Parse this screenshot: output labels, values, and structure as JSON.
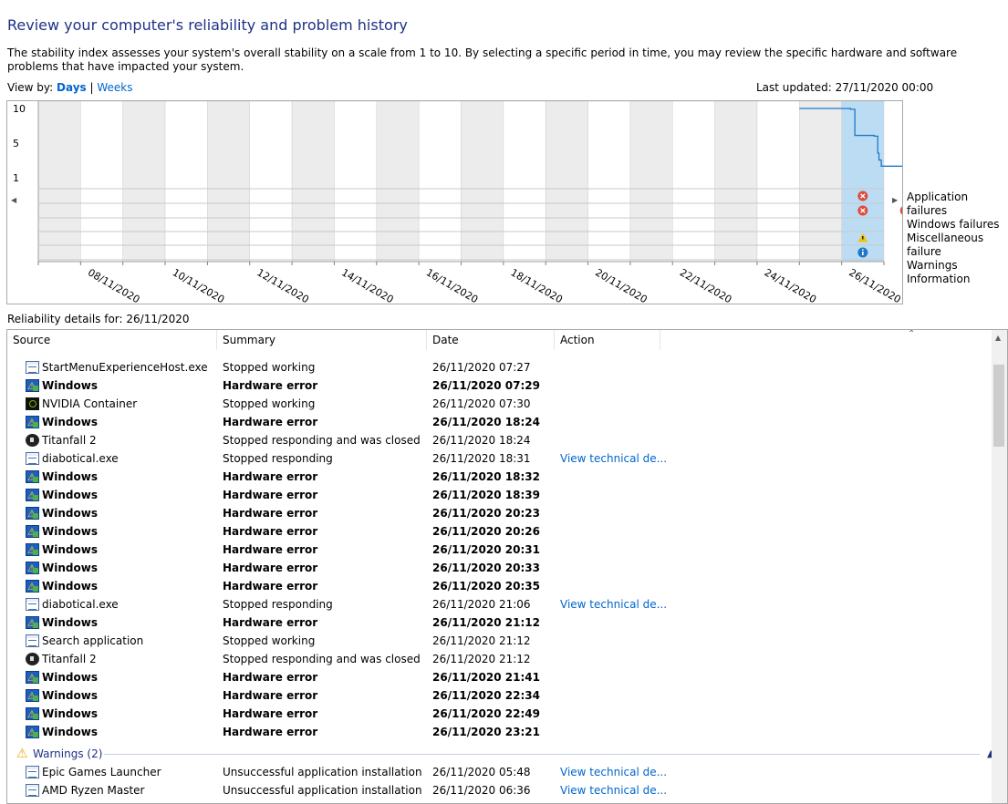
{
  "page": {
    "title": "Review your computer's reliability and problem history",
    "description": "The stability index assesses your system's overall stability on a scale from 1 to 10. By selecting a specific period in time, you may review the specific hardware and software problems that have impacted your system.",
    "view_by_label": "View by:",
    "view_days": "Days",
    "view_sep": "|",
    "view_weeks": "Weeks",
    "last_updated": "Last updated: 27/11/2020 00:00",
    "details_for": "Reliability details for: 26/11/2020"
  },
  "chart_data": {
    "type": "line",
    "y_ticks": [
      "10",
      "5",
      "1"
    ],
    "ylim": [
      1,
      10
    ],
    "x_labels": [
      "08/11/2020",
      "10/11/2020",
      "12/11/2020",
      "14/11/2020",
      "16/11/2020",
      "18/11/2020",
      "20/11/2020",
      "22/11/2020",
      "24/11/2020",
      "26/11/2020"
    ],
    "selected_day": "26/11/2020",
    "stability_index": [
      {
        "x": "25/11/2020 00:00",
        "y": 10.0
      },
      {
        "x": "26/11/2020 00:00",
        "y": 10.0
      },
      {
        "x": "26/11/2020 05:00",
        "y": 9.9
      },
      {
        "x": "26/11/2020 07:30",
        "y": 6.5
      },
      {
        "x": "26/11/2020 18:30",
        "y": 6.4
      },
      {
        "x": "26/11/2020 20:30",
        "y": 4.2
      },
      {
        "x": "26/11/2020 21:10",
        "y": 3.3
      },
      {
        "x": "26/11/2020 22:30",
        "y": 2.5
      },
      {
        "x": "27/11/2020 00:00",
        "y": 2.5
      },
      {
        "x": "28/11/2020 00:00",
        "y": 2.5
      }
    ],
    "event_rows": [
      "Application failures",
      "Windows failures",
      "Miscellaneous failure",
      "Warnings",
      "Information"
    ],
    "events": [
      {
        "row": "Application failures",
        "day": "26/11/2020",
        "icon": "error-icon"
      },
      {
        "row": "Windows failures",
        "day": "26/11/2020",
        "icon": "error-icon"
      },
      {
        "row": "Windows failures",
        "day": "27/11/2020",
        "icon": "error-icon"
      },
      {
        "row": "Warnings",
        "day": "26/11/2020",
        "icon": "warning-icon"
      },
      {
        "row": "Information",
        "day": "26/11/2020",
        "icon": "info-icon"
      }
    ],
    "colors": {
      "line": "#1e78c8",
      "selected": "#bcdcf4",
      "shade": "#ececec",
      "error": "#e04a3c",
      "warning": "#f5c400",
      "info": "#1e78c8"
    }
  },
  "table": {
    "headers": [
      "Source",
      "Summary",
      "Date",
      "Action"
    ],
    "rows": [
      {
        "icon": "app-icon",
        "source": "StartMenuExperienceHost.exe",
        "summary": "Stopped working",
        "date": "26/11/2020 07:27",
        "action": "",
        "bold": false
      },
      {
        "icon": "windows-icon",
        "source": "Windows",
        "summary": "Hardware error",
        "date": "26/11/2020 07:29",
        "action": "",
        "bold": true
      },
      {
        "icon": "nvidia-icon",
        "source": "NVIDIA Container",
        "summary": "Stopped working",
        "date": "26/11/2020 07:30",
        "action": "",
        "bold": false
      },
      {
        "icon": "windows-icon",
        "source": "Windows",
        "summary": "Hardware error",
        "date": "26/11/2020 18:24",
        "action": "",
        "bold": true
      },
      {
        "icon": "titanfall-icon",
        "source": "Titanfall 2",
        "summary": "Stopped responding and was closed",
        "date": "26/11/2020 18:24",
        "action": "",
        "bold": false
      },
      {
        "icon": "app-icon",
        "source": "diabotical.exe",
        "summary": "Stopped responding",
        "date": "26/11/2020 18:31",
        "action": "View technical de...",
        "bold": false
      },
      {
        "icon": "windows-icon",
        "source": "Windows",
        "summary": "Hardware error",
        "date": "26/11/2020 18:32",
        "action": "",
        "bold": true
      },
      {
        "icon": "windows-icon",
        "source": "Windows",
        "summary": "Hardware error",
        "date": "26/11/2020 18:39",
        "action": "",
        "bold": true
      },
      {
        "icon": "windows-icon",
        "source": "Windows",
        "summary": "Hardware error",
        "date": "26/11/2020 20:23",
        "action": "",
        "bold": true
      },
      {
        "icon": "windows-icon",
        "source": "Windows",
        "summary": "Hardware error",
        "date": "26/11/2020 20:26",
        "action": "",
        "bold": true
      },
      {
        "icon": "windows-icon",
        "source": "Windows",
        "summary": "Hardware error",
        "date": "26/11/2020 20:31",
        "action": "",
        "bold": true
      },
      {
        "icon": "windows-icon",
        "source": "Windows",
        "summary": "Hardware error",
        "date": "26/11/2020 20:33",
        "action": "",
        "bold": true
      },
      {
        "icon": "windows-icon",
        "source": "Windows",
        "summary": "Hardware error",
        "date": "26/11/2020 20:35",
        "action": "",
        "bold": true
      },
      {
        "icon": "app-icon",
        "source": "diabotical.exe",
        "summary": "Stopped responding",
        "date": "26/11/2020 21:06",
        "action": "View technical de...",
        "bold": false
      },
      {
        "icon": "windows-icon",
        "source": "Windows",
        "summary": "Hardware error",
        "date": "26/11/2020 21:12",
        "action": "",
        "bold": true
      },
      {
        "icon": "app-icon",
        "source": "Search application",
        "summary": "Stopped working",
        "date": "26/11/2020 21:12",
        "action": "",
        "bold": false
      },
      {
        "icon": "titanfall-icon",
        "source": "Titanfall 2",
        "summary": "Stopped responding and was closed",
        "date": "26/11/2020 21:12",
        "action": "",
        "bold": false
      },
      {
        "icon": "windows-icon",
        "source": "Windows",
        "summary": "Hardware error",
        "date": "26/11/2020 21:41",
        "action": "",
        "bold": true
      },
      {
        "icon": "windows-icon",
        "source": "Windows",
        "summary": "Hardware error",
        "date": "26/11/2020 22:34",
        "action": "",
        "bold": true
      },
      {
        "icon": "windows-icon",
        "source": "Windows",
        "summary": "Hardware error",
        "date": "26/11/2020 22:49",
        "action": "",
        "bold": true
      },
      {
        "icon": "windows-icon",
        "source": "Windows",
        "summary": "Hardware error",
        "date": "26/11/2020 23:21",
        "action": "",
        "bold": true
      }
    ],
    "warnings_group": {
      "label": "Warnings (2)"
    },
    "warning_rows": [
      {
        "icon": "app-icon",
        "source": "Epic Games Launcher",
        "summary": "Unsuccessful application installation",
        "date": "26/11/2020 05:48",
        "action": "View technical de..."
      },
      {
        "icon": "app-icon",
        "source": "AMD Ryzen Master",
        "summary": "Unsuccessful application installation",
        "date": "26/11/2020 06:36",
        "action": "View technical de..."
      }
    ]
  }
}
